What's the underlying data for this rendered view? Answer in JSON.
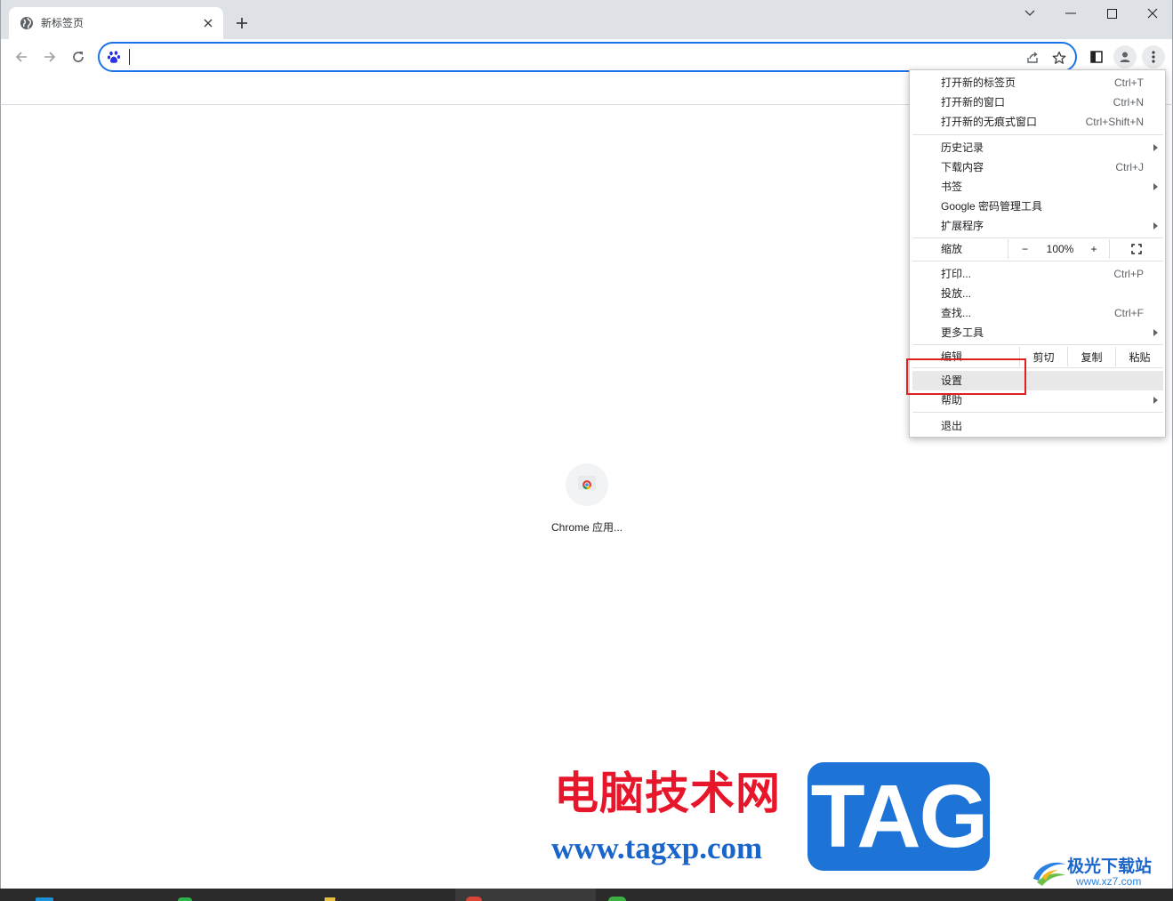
{
  "tab": {
    "title": "新标签页"
  },
  "omnibox": {
    "value": ""
  },
  "shortcut": {
    "label": "Chrome 应用..."
  },
  "menu": {
    "new_tab": {
      "label": "打开新的标签页",
      "shortcut": "Ctrl+T"
    },
    "new_window": {
      "label": "打开新的窗口",
      "shortcut": "Ctrl+N"
    },
    "incognito": {
      "label": "打开新的无痕式窗口",
      "shortcut": "Ctrl+Shift+N"
    },
    "history": {
      "label": "历史记录"
    },
    "downloads": {
      "label": "下载内容",
      "shortcut": "Ctrl+J"
    },
    "bookmarks": {
      "label": "书签"
    },
    "password_manager": {
      "label": "Google 密码管理工具"
    },
    "extensions": {
      "label": "扩展程序"
    },
    "zoom": {
      "label": "缩放",
      "minus": "−",
      "value": "100%",
      "plus": "+"
    },
    "print": {
      "label": "打印...",
      "shortcut": "Ctrl+P"
    },
    "cast": {
      "label": "投放..."
    },
    "find": {
      "label": "查找...",
      "shortcut": "Ctrl+F"
    },
    "more_tools": {
      "label": "更多工具"
    },
    "edit": {
      "label": "编辑",
      "cut": "剪切",
      "copy": "复制",
      "paste": "粘贴"
    },
    "settings": {
      "label": "设置"
    },
    "help": {
      "label": "帮助"
    },
    "exit": {
      "label": "退出"
    }
  },
  "watermark": {
    "site_name": "电脑技术网",
    "site_url": "www.tagxp.com",
    "tag": "TAG",
    "logo2_name": "极光下载站",
    "logo2_url": "www.xz7.com"
  },
  "colors": {
    "accent": "#1a73e8",
    "highlight_box": "#e02020",
    "watermark_red": "#e8162a",
    "watermark_blue": "#1d74d6"
  }
}
